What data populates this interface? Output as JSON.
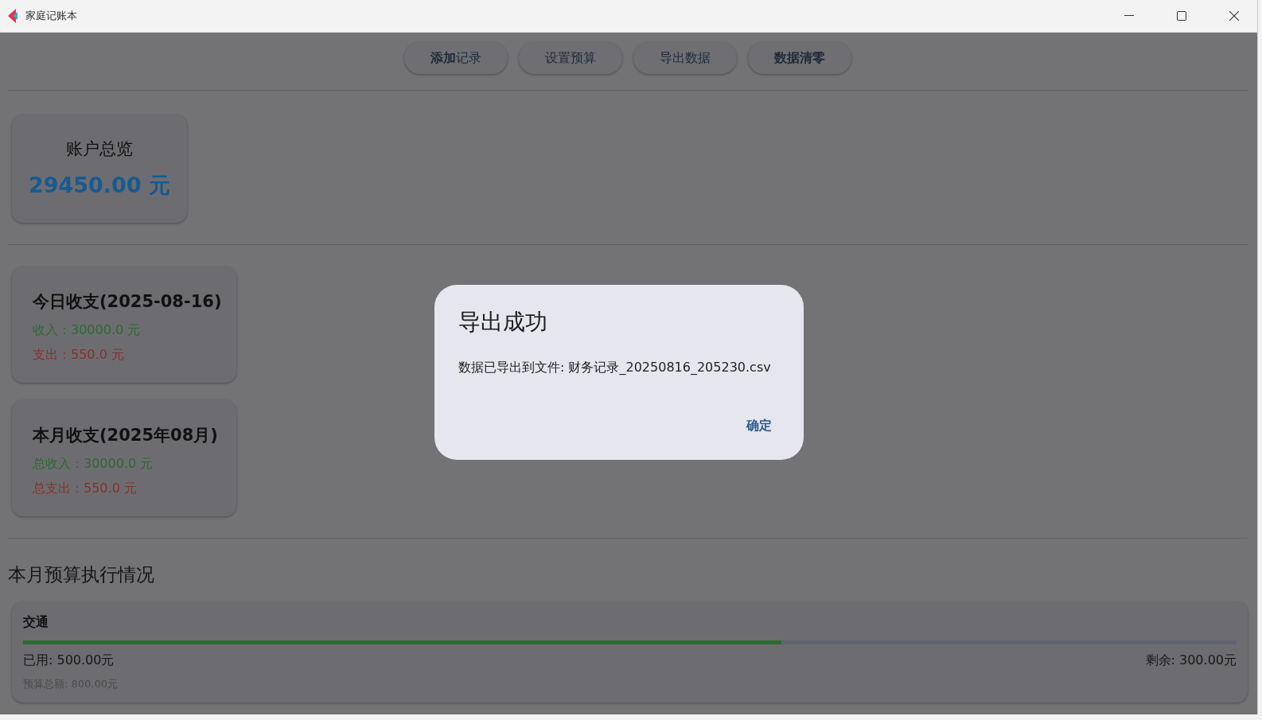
{
  "window": {
    "title": "家庭记账本"
  },
  "toolbar": [
    {
      "label": "**添加**记录",
      "bold": false
    },
    {
      "label": "设置预算",
      "bold": false
    },
    {
      "label": "导出数据",
      "bold": false
    },
    {
      "label": "数据清零",
      "bold": true
    }
  ],
  "overview": {
    "title": "账户总览",
    "balance": "29450.00 元"
  },
  "today": {
    "title": "今日收支(2025-08-16)",
    "income": "收入：30000.0 元",
    "expense": "支出：550.0 元"
  },
  "month": {
    "title": "本月收支(2025年08月)",
    "income": "总收入：30000.0 元",
    "expense": "总支出：550.0 元"
  },
  "budget": {
    "heading": "本月预算执行情况",
    "items": [
      {
        "category": "交通",
        "level": 0.625,
        "used": "已用: 500.00元",
        "remaining": "剩余: 300.00元",
        "total": "预算总额: 800.00元"
      }
    ]
  },
  "dialog": {
    "title": "导出成功",
    "message": "数据已导出到文件: 财务记录_20250816_205230.csv",
    "button": "确定"
  }
}
